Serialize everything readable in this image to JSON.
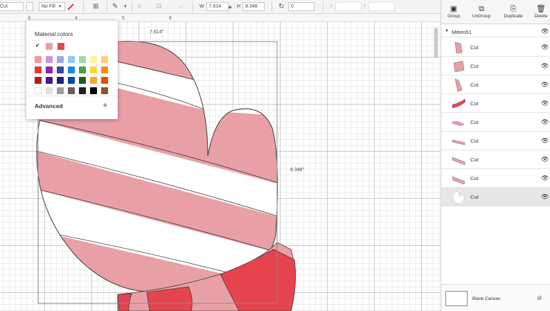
{
  "toolbar": {
    "font_value": "Cut",
    "fill_label": "No Fill",
    "w_label": "W",
    "w_value": "7.614",
    "h_label": "H",
    "h_value": "8.348",
    "rotate_value": "0",
    "x_label": "X",
    "y_label": "Y",
    "colors": {
      "pen": "#d9363e"
    }
  },
  "canvas": {
    "ruler_ticks": [
      "3",
      "4",
      "5",
      "6"
    ],
    "width_label": "7.614\"",
    "height_label": "8.348\"",
    "mitten_colors": {
      "pink": "#e8a0a6",
      "red": "#e5444e",
      "white": "#ffffff",
      "outline": "#3a3a3a"
    }
  },
  "color_popup": {
    "title": "Material colors",
    "recent": [
      "#e8a0a6",
      "#e5444e"
    ],
    "palette": [
      [
        "#ef9a9a",
        "#ce93d8",
        "#9fa8da",
        "#90caf9",
        "#a5d6a7",
        "#fff59d",
        "#ffcc80"
      ],
      [
        "#e53935",
        "#8e24aa",
        "#3949ab",
        "#1e88e5",
        "#43a047",
        "#fdd835",
        "#fb8c00"
      ],
      [
        "#b71c1c",
        "#4a148c",
        "#1a237e",
        "#0d47a1",
        "#1b5e20",
        "#f9a825",
        "#e65100"
      ],
      [
        "#ffffff",
        "#e0e0e0",
        "#9e9e9e",
        "#616161",
        "#212121",
        "#000000",
        "#8d5524"
      ]
    ],
    "advanced_label": "Advanced",
    "add_symbol": "+"
  },
  "panel": {
    "buttons": [
      {
        "label": "Group",
        "icon": "group-icon",
        "enabled": false
      },
      {
        "label": "UnGroup",
        "icon": "ungroup-icon",
        "enabled": true
      },
      {
        "label": "Duplicate",
        "icon": "duplicate-icon",
        "enabled": true
      },
      {
        "label": "Delete",
        "icon": "trash-icon",
        "enabled": true
      }
    ],
    "group_name": "Mitten51",
    "layers": [
      {
        "label": "Cut",
        "color": "#e8a0a6",
        "selected": false
      },
      {
        "label": "Cut",
        "color": "#e8a0a6",
        "selected": false
      },
      {
        "label": "Cut",
        "color": "#e8a0a6",
        "selected": false
      },
      {
        "label": "Cut",
        "color": "#e5444e",
        "selected": false
      },
      {
        "label": "Cut",
        "color": "#e8a0a6",
        "selected": false
      },
      {
        "label": "Cut",
        "color": "#e8a0a6",
        "selected": false
      },
      {
        "label": "Cut",
        "color": "#e8a0a6",
        "selected": false
      },
      {
        "label": "Cut",
        "color": "#e8a0a6",
        "selected": false
      },
      {
        "label": "Cut",
        "color": "#ffffff",
        "selected": true
      }
    ],
    "blank_canvas_label": "Blank Canvas"
  }
}
